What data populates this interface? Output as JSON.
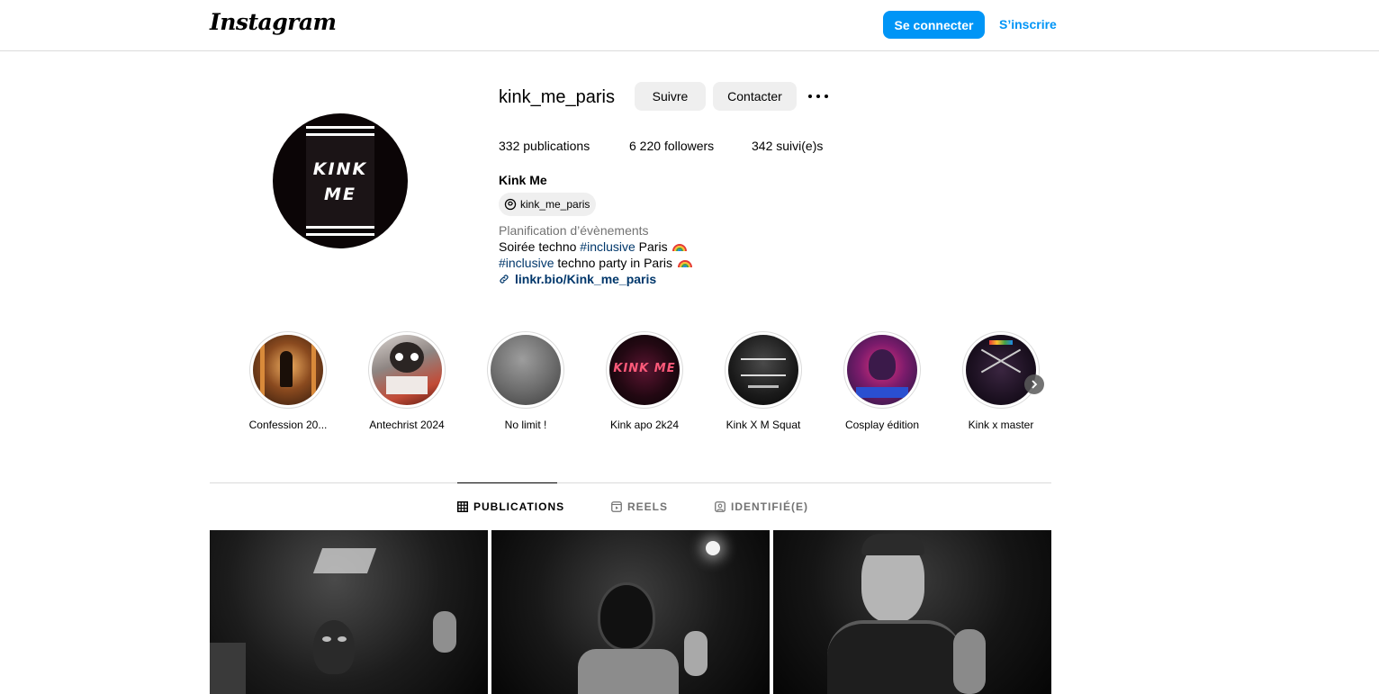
{
  "header": {
    "logo": "Instagram",
    "login_label": "Se connecter",
    "signup_label": "S’inscrire"
  },
  "profile": {
    "avatar_text_line1": "KINK",
    "avatar_text_line2": "ME",
    "username": "kink_me_paris",
    "follow_label": "Suivre",
    "contact_label": "Contacter",
    "stats": {
      "posts_count": "332",
      "posts_label": "publications",
      "followers_count": "6 220",
      "followers_label": "followers",
      "following_count": "342",
      "following_label": "suivi(e)s"
    },
    "full_name": "Kink Me",
    "threads_handle": "kink_me_paris",
    "category": "Planification d’évènements",
    "bio": {
      "line1_a": "Soirée techno ",
      "line1_tag": "#inclusive",
      "line1_b": " Paris",
      "line2_tag": "#inclusive",
      "line2_b": " techno party in Paris",
      "link": "linkr.bio/Kink_me_paris"
    }
  },
  "highlights": [
    {
      "label": "Confession 20..."
    },
    {
      "label": "Antechrist 2024"
    },
    {
      "label": "No limit !"
    },
    {
      "label": "Kink apo 2k24"
    },
    {
      "label": "Kink X M Squat"
    },
    {
      "label": "Cosplay édition"
    },
    {
      "label": "Kink x master"
    }
  ],
  "tabs": [
    {
      "label": "PUBLICATIONS",
      "active": true
    },
    {
      "label": "REELS",
      "active": false
    },
    {
      "label": "IDENTIFIÉ(E)",
      "active": false
    }
  ],
  "colors": {
    "accent": "#0095f6",
    "link": "#00376b",
    "button_gray": "#efefef",
    "border": "#dbdbdb",
    "muted": "#737373"
  }
}
